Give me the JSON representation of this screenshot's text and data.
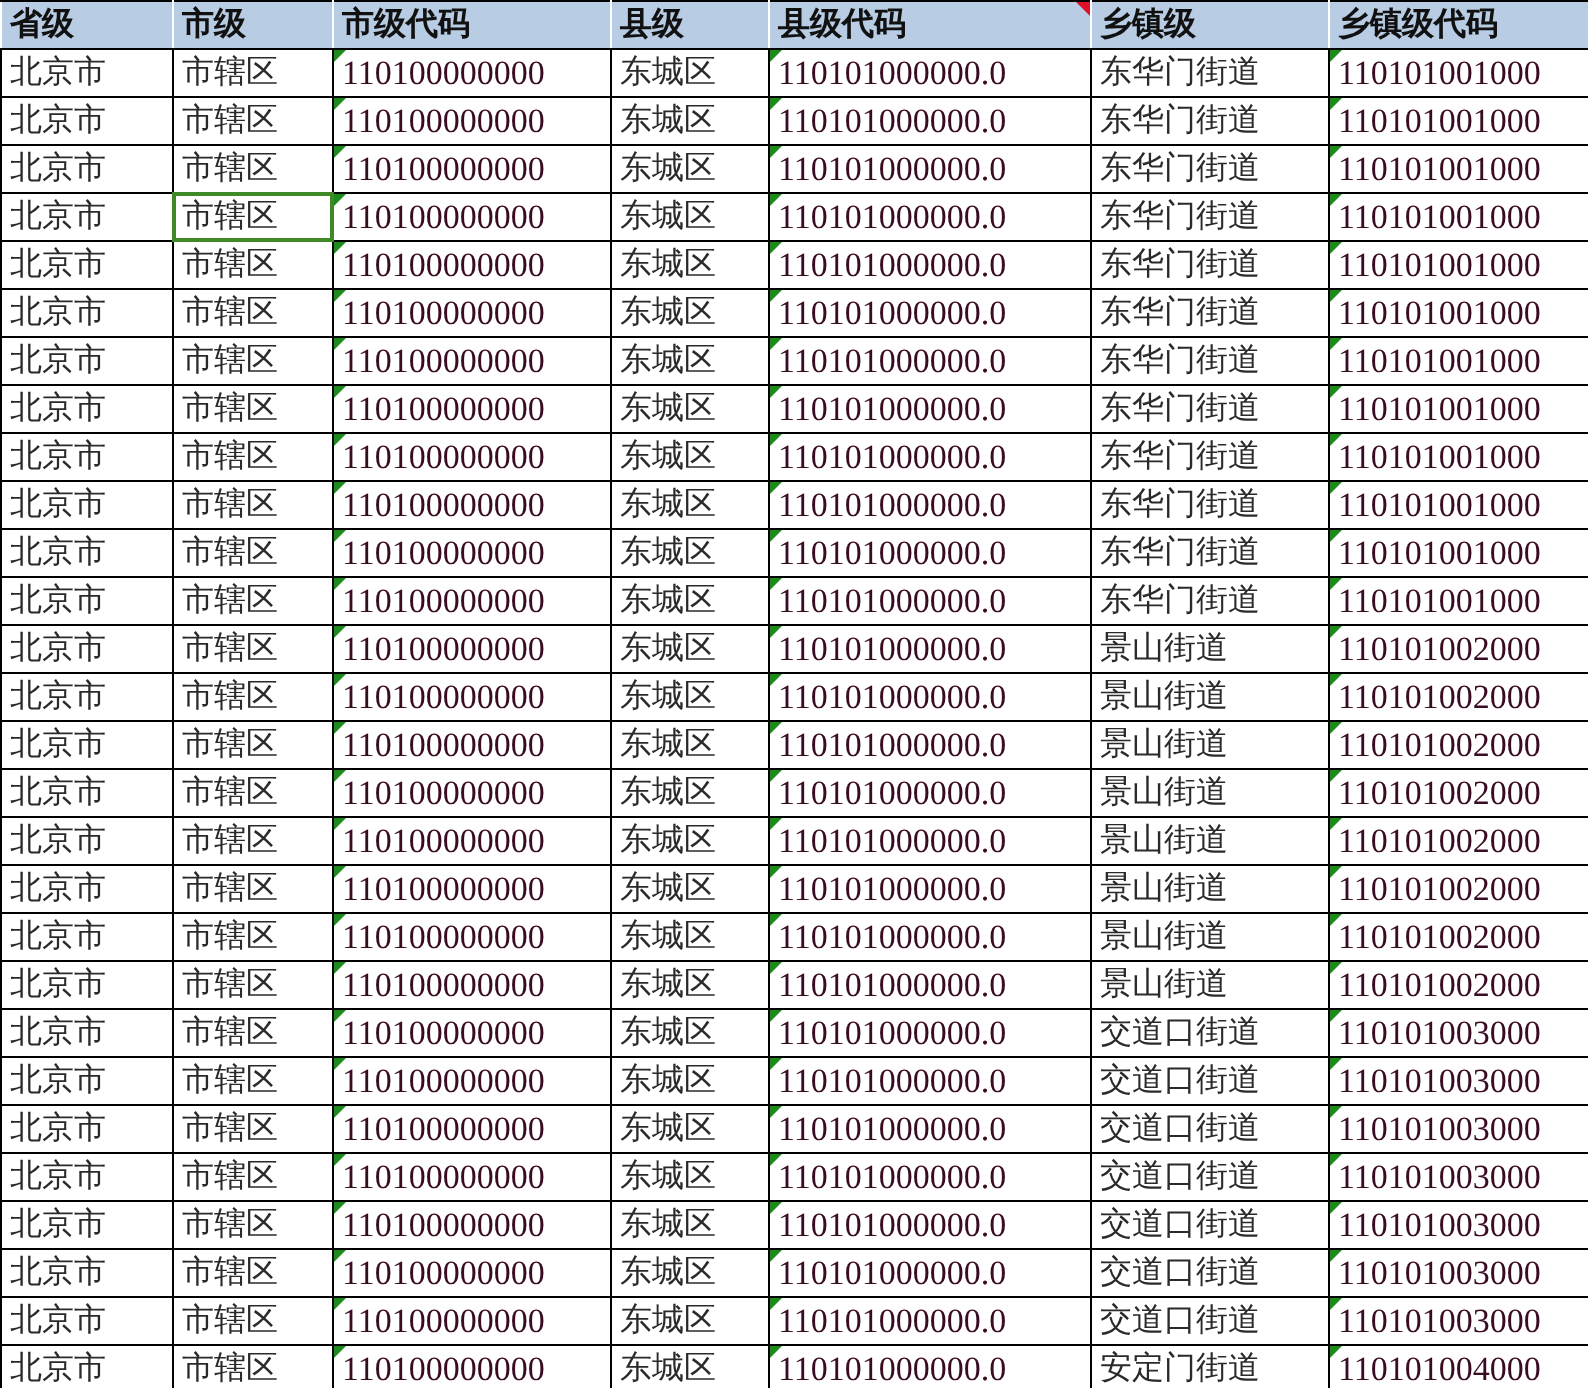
{
  "columns": [
    {
      "label": "省级",
      "kind": "text",
      "comment": false
    },
    {
      "label": "市级",
      "kind": "text",
      "comment": false
    },
    {
      "label": "市级代码",
      "kind": "code",
      "comment": false
    },
    {
      "label": "县级",
      "kind": "text",
      "comment": false
    },
    {
      "label": "县级代码",
      "kind": "code",
      "comment": true
    },
    {
      "label": "乡镇级",
      "kind": "text",
      "comment": false
    },
    {
      "label": "乡镇级代码",
      "kind": "code",
      "comment": false
    }
  ],
  "rows": [
    {
      "cells": [
        "北京市",
        "市辖区",
        "110100000000",
        "东城区",
        "110101000000.0",
        "东华门街道",
        "110101001000"
      ],
      "selected": [
        false,
        false,
        false,
        false,
        false,
        false,
        false
      ]
    },
    {
      "cells": [
        "北京市",
        "市辖区",
        "110100000000",
        "东城区",
        "110101000000.0",
        "东华门街道",
        "110101001000"
      ],
      "selected": [
        false,
        false,
        false,
        false,
        false,
        false,
        false
      ]
    },
    {
      "cells": [
        "北京市",
        "市辖区",
        "110100000000",
        "东城区",
        "110101000000.0",
        "东华门街道",
        "110101001000"
      ],
      "selected": [
        false,
        false,
        false,
        false,
        false,
        false,
        false
      ]
    },
    {
      "cells": [
        "北京市",
        "市辖区",
        "110100000000",
        "东城区",
        "110101000000.0",
        "东华门街道",
        "110101001000"
      ],
      "selected": [
        false,
        true,
        false,
        false,
        false,
        false,
        false
      ]
    },
    {
      "cells": [
        "北京市",
        "市辖区",
        "110100000000",
        "东城区",
        "110101000000.0",
        "东华门街道",
        "110101001000"
      ],
      "selected": [
        false,
        false,
        false,
        false,
        false,
        false,
        false
      ]
    },
    {
      "cells": [
        "北京市",
        "市辖区",
        "110100000000",
        "东城区",
        "110101000000.0",
        "东华门街道",
        "110101001000"
      ],
      "selected": [
        false,
        false,
        false,
        false,
        false,
        false,
        false
      ]
    },
    {
      "cells": [
        "北京市",
        "市辖区",
        "110100000000",
        "东城区",
        "110101000000.0",
        "东华门街道",
        "110101001000"
      ],
      "selected": [
        false,
        false,
        false,
        false,
        false,
        false,
        false
      ]
    },
    {
      "cells": [
        "北京市",
        "市辖区",
        "110100000000",
        "东城区",
        "110101000000.0",
        "东华门街道",
        "110101001000"
      ],
      "selected": [
        false,
        false,
        false,
        false,
        false,
        false,
        false
      ]
    },
    {
      "cells": [
        "北京市",
        "市辖区",
        "110100000000",
        "东城区",
        "110101000000.0",
        "东华门街道",
        "110101001000"
      ],
      "selected": [
        false,
        false,
        false,
        false,
        false,
        false,
        false
      ]
    },
    {
      "cells": [
        "北京市",
        "市辖区",
        "110100000000",
        "东城区",
        "110101000000.0",
        "东华门街道",
        "110101001000"
      ],
      "selected": [
        false,
        false,
        false,
        false,
        false,
        false,
        false
      ]
    },
    {
      "cells": [
        "北京市",
        "市辖区",
        "110100000000",
        "东城区",
        "110101000000.0",
        "东华门街道",
        "110101001000"
      ],
      "selected": [
        false,
        false,
        false,
        false,
        false,
        false,
        false
      ]
    },
    {
      "cells": [
        "北京市",
        "市辖区",
        "110100000000",
        "东城区",
        "110101000000.0",
        "东华门街道",
        "110101001000"
      ],
      "selected": [
        false,
        false,
        false,
        false,
        false,
        false,
        false
      ]
    },
    {
      "cells": [
        "北京市",
        "市辖区",
        "110100000000",
        "东城区",
        "110101000000.0",
        "景山街道",
        "110101002000"
      ],
      "selected": [
        false,
        false,
        false,
        false,
        false,
        false,
        false
      ]
    },
    {
      "cells": [
        "北京市",
        "市辖区",
        "110100000000",
        "东城区",
        "110101000000.0",
        "景山街道",
        "110101002000"
      ],
      "selected": [
        false,
        false,
        false,
        false,
        false,
        false,
        false
      ]
    },
    {
      "cells": [
        "北京市",
        "市辖区",
        "110100000000",
        "东城区",
        "110101000000.0",
        "景山街道",
        "110101002000"
      ],
      "selected": [
        false,
        false,
        false,
        false,
        false,
        false,
        false
      ]
    },
    {
      "cells": [
        "北京市",
        "市辖区",
        "110100000000",
        "东城区",
        "110101000000.0",
        "景山街道",
        "110101002000"
      ],
      "selected": [
        false,
        false,
        false,
        false,
        false,
        false,
        false
      ]
    },
    {
      "cells": [
        "北京市",
        "市辖区",
        "110100000000",
        "东城区",
        "110101000000.0",
        "景山街道",
        "110101002000"
      ],
      "selected": [
        false,
        false,
        false,
        false,
        false,
        false,
        false
      ]
    },
    {
      "cells": [
        "北京市",
        "市辖区",
        "110100000000",
        "东城区",
        "110101000000.0",
        "景山街道",
        "110101002000"
      ],
      "selected": [
        false,
        false,
        false,
        false,
        false,
        false,
        false
      ]
    },
    {
      "cells": [
        "北京市",
        "市辖区",
        "110100000000",
        "东城区",
        "110101000000.0",
        "景山街道",
        "110101002000"
      ],
      "selected": [
        false,
        false,
        false,
        false,
        false,
        false,
        false
      ]
    },
    {
      "cells": [
        "北京市",
        "市辖区",
        "110100000000",
        "东城区",
        "110101000000.0",
        "景山街道",
        "110101002000"
      ],
      "selected": [
        false,
        false,
        false,
        false,
        false,
        false,
        false
      ]
    },
    {
      "cells": [
        "北京市",
        "市辖区",
        "110100000000",
        "东城区",
        "110101000000.0",
        "交道口街道",
        "110101003000"
      ],
      "selected": [
        false,
        false,
        false,
        false,
        false,
        false,
        false
      ]
    },
    {
      "cells": [
        "北京市",
        "市辖区",
        "110100000000",
        "东城区",
        "110101000000.0",
        "交道口街道",
        "110101003000"
      ],
      "selected": [
        false,
        false,
        false,
        false,
        false,
        false,
        false
      ]
    },
    {
      "cells": [
        "北京市",
        "市辖区",
        "110100000000",
        "东城区",
        "110101000000.0",
        "交道口街道",
        "110101003000"
      ],
      "selected": [
        false,
        false,
        false,
        false,
        false,
        false,
        false
      ]
    },
    {
      "cells": [
        "北京市",
        "市辖区",
        "110100000000",
        "东城区",
        "110101000000.0",
        "交道口街道",
        "110101003000"
      ],
      "selected": [
        false,
        false,
        false,
        false,
        false,
        false,
        false
      ]
    },
    {
      "cells": [
        "北京市",
        "市辖区",
        "110100000000",
        "东城区",
        "110101000000.0",
        "交道口街道",
        "110101003000"
      ],
      "selected": [
        false,
        false,
        false,
        false,
        false,
        false,
        false
      ]
    },
    {
      "cells": [
        "北京市",
        "市辖区",
        "110100000000",
        "东城区",
        "110101000000.0",
        "交道口街道",
        "110101003000"
      ],
      "selected": [
        false,
        false,
        false,
        false,
        false,
        false,
        false
      ]
    },
    {
      "cells": [
        "北京市",
        "市辖区",
        "110100000000",
        "东城区",
        "110101000000.0",
        "交道口街道",
        "110101003000"
      ],
      "selected": [
        false,
        false,
        false,
        false,
        false,
        false,
        false
      ]
    },
    {
      "cells": [
        "北京市",
        "市辖区",
        "110100000000",
        "东城区",
        "110101000000.0",
        "安定门街道",
        "110101004000"
      ],
      "selected": [
        false,
        false,
        false,
        false,
        false,
        false,
        false
      ]
    }
  ]
}
